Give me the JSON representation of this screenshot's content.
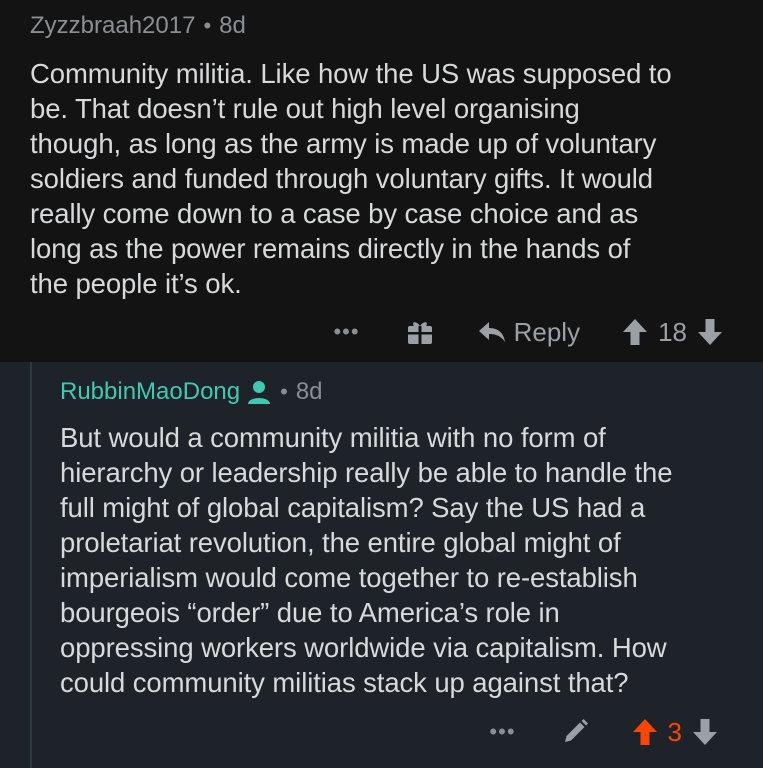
{
  "top_comment": {
    "author": "Zyzzbraah2017",
    "separator": "•",
    "age": "8d",
    "body_lines": [
      "Community militia. Like how the US was supposed to",
      "be. That doesn’t rule out high level organising",
      "though, as long as the army is made up of voluntary",
      "soldiers and funded through voluntary gifts. It would",
      "really come down to a case by case choice and as",
      "long as the power remains directly in the hands of",
      "the people it’s ok."
    ],
    "actions": {
      "more_label": "•••",
      "reply_label": "Reply",
      "vote_count": "18"
    }
  },
  "reply_comment": {
    "author": "RubbinMaoDong",
    "separator": "•",
    "age": "8d",
    "body_lines": [
      "But would a community militia with no form of",
      "hierarchy or leadership really be able to handle the",
      "full might of global capitalism? Say the US had a",
      "proletariat revolution, the entire global might of",
      "imperialism would come together to re-establish",
      "bourgeois “order” due to America’s role in",
      "oppressing workers worldwide via capitalism. How",
      "could community militias stack up against that?"
    ],
    "actions": {
      "more_label": "•••",
      "vote_count": "3"
    }
  },
  "colors": {
    "background_top": "#131313",
    "background_reply": "#1d2329",
    "author_reply": "#3fc9b4",
    "upvote_active": "#ff4500",
    "text": "#d8d9da",
    "meta": "#8a8f94"
  },
  "icons": {
    "gift": "gift-icon",
    "reply": "reply-arrow-icon",
    "upvote": "upvote-arrow-icon",
    "downvote": "downvote-arrow-icon",
    "edit": "pencil-icon",
    "verified": "user-verified-icon"
  }
}
